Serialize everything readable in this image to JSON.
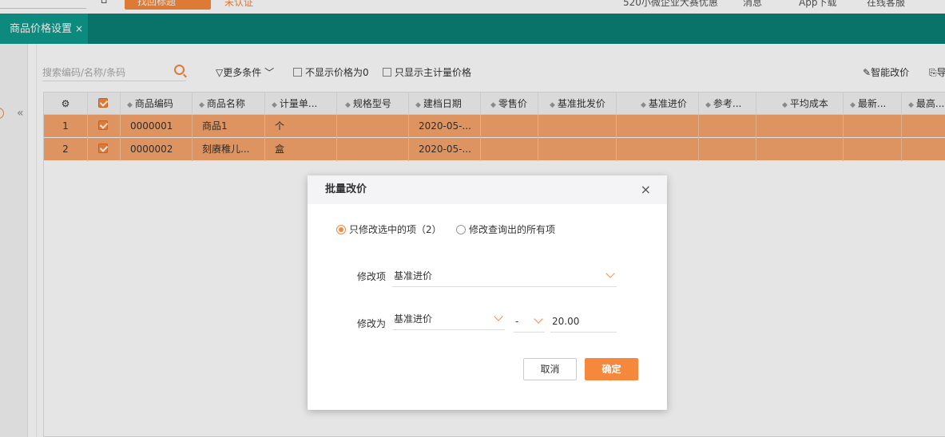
{
  "topbar": {
    "orange_button": "找回标题",
    "unverified": "未认证",
    "promo": "520小微企业大赛优惠",
    "messages": "消息",
    "app_download": "App下载",
    "online_service": "在线客服"
  },
  "tab": {
    "label": "商品价格设置",
    "close": "×"
  },
  "toolbar": {
    "search_placeholder": "搜索编码/名称/条码",
    "more_conditions": "更多条件",
    "hide_zero": "不显示价格为0",
    "main_unit_only": "只显示主计量价格",
    "smart_price": "智能改价",
    "other": "导"
  },
  "table": {
    "headers": [
      "商品编码",
      "商品名称",
      "计量单...",
      "规格型号",
      "建档日期",
      "零售价",
      "基准批发价",
      "基准进价",
      "参考...",
      "平均成本",
      "最新...",
      "最高..."
    ],
    "rows": [
      {
        "no": "1",
        "code": "0000001",
        "name": "商品1",
        "unit": "个",
        "spec": "",
        "date": "2020-05-..."
      },
      {
        "no": "2",
        "code": "0000002",
        "name": "刻赓稚儿...",
        "unit": "盒",
        "spec": "",
        "date": "2020-05-..."
      }
    ]
  },
  "modal": {
    "title": "批量改价",
    "close": "×",
    "radio_selected": "只修改选中的项（2）",
    "radio_all": "修改查询出的所有项",
    "field1_label": "修改项",
    "field1_value": "基准进价",
    "field2_label": "修改为",
    "field2_value": "基准进价",
    "operator": "-",
    "amount": "20.00",
    "cancel": "取消",
    "confirm": "确定"
  },
  "colors": {
    "accent": "#f5883d",
    "tabbar": "#0b8075",
    "row_selected": "#f6a56c"
  }
}
